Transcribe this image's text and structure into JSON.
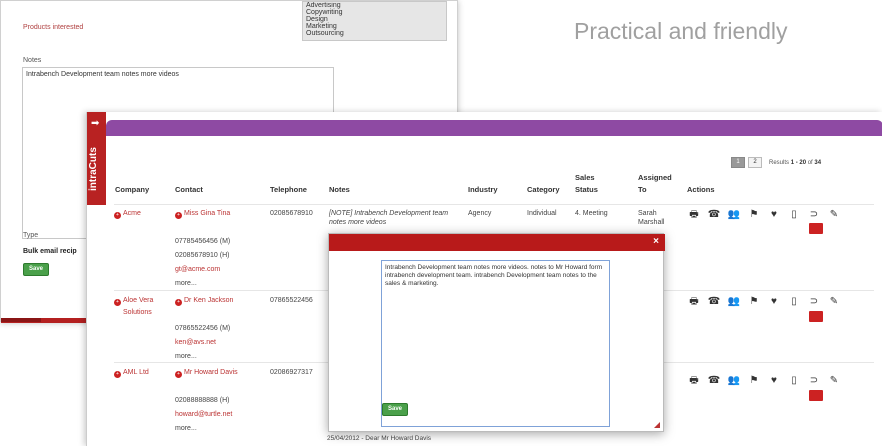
{
  "tagline": "Practical and friendly",
  "back_form": {
    "products_label": "Products interested",
    "products_options": [
      "Advertising",
      "Copywriting",
      "Design",
      "Marketing",
      "Outsourcing"
    ],
    "notes_label": "Notes",
    "notes_value": "Intrabench Development team notes more videos",
    "type_label": "Type",
    "bulk_label": "Bulk email recip",
    "save_label": "Save"
  },
  "side_tab": {
    "logo_text": "intraCuts"
  },
  "pager": {
    "page1": "1",
    "page2": "2",
    "results_prefix": "Results",
    "results_range": "1 - 20",
    "results_of": "of",
    "results_total": "34"
  },
  "columns": {
    "company": "Company",
    "contact": "Contact",
    "telephone": "Telephone",
    "notes": "Notes",
    "industry": "Industry",
    "category": "Category",
    "sales_status_1": "Sales",
    "sales_status_2": "Status",
    "assigned_1": "Assigned",
    "assigned_2": "To",
    "actions": "Actions"
  },
  "rows": [
    {
      "company": "Acme",
      "contact": "Miss Gina Tina",
      "telephone": "02085678910",
      "notes": "[NOTE] Intrabench Development team",
      "notes_more": "notes more videos",
      "industry": "Agency",
      "category": "Individual",
      "status": "4. Meeting",
      "assigned": "Sarah",
      "assigned2": "Marshall",
      "phones": [
        "07785456456 (M)",
        "02085678910 (H)"
      ],
      "email": "gt@acme.com",
      "more": "more..."
    },
    {
      "company": "Aloe Vera",
      "company2": "Solutions",
      "contact": "Dr Ken Jackson",
      "telephone": "07865522456",
      "phones": [
        "07865522456 (M)"
      ],
      "email": "ken@avs.net",
      "more": "more..."
    },
    {
      "company": "AML Ltd",
      "contact": "Mr Howard Davis",
      "telephone": "02086927317",
      "phones": [
        "02088888888 (H)"
      ],
      "email": "howard@turtle.net",
      "more": "more..."
    }
  ],
  "modal": {
    "text": "Intrabench Development team notes more videos. notes to Mr Howard form intrabench development team. intrabench Development team notes to the sales & marketing.",
    "save_label": "Save",
    "close_label": "×"
  },
  "footer_note": "25/04/2012 - Dear Mr Howard Davis",
  "colors": {
    "purple_bar": "#8e4aa3",
    "modal_header": "#b81a1a",
    "save_green": "#4aa04a"
  }
}
